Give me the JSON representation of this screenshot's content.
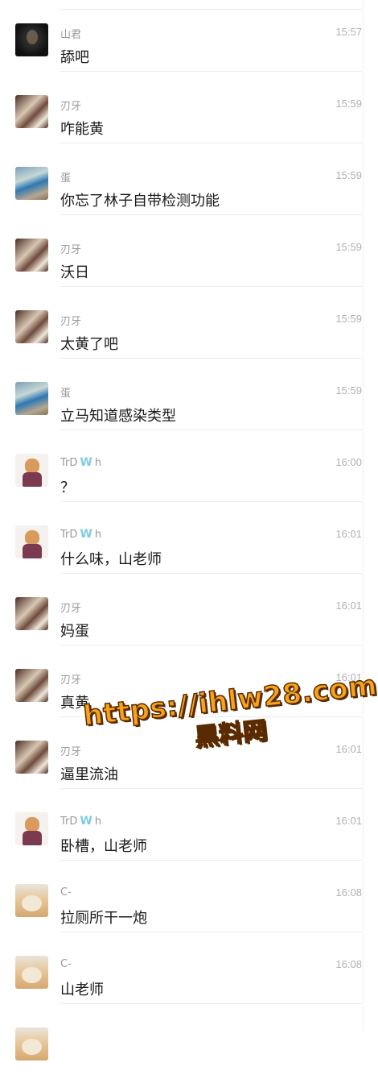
{
  "messages": [
    {
      "sender": "山君",
      "time": "15:57",
      "text": "舔吧",
      "avatar": "dark-portrait"
    },
    {
      "sender": "刃牙",
      "time": "15:59",
      "text": "咋能黄",
      "avatar": "flowers"
    },
    {
      "sender": "蛋",
      "time": "15:59",
      "text": "你忘了林子自带检测功能",
      "avatar": "egg-photo"
    },
    {
      "sender": "刃牙",
      "time": "15:59",
      "text": "沃日",
      "avatar": "flowers"
    },
    {
      "sender": "刃牙",
      "time": "15:59",
      "text": "太黄了吧",
      "avatar": "flowers"
    },
    {
      "sender": "蛋",
      "time": "15:59",
      "text": "立马知道感染类型",
      "avatar": "egg-photo"
    },
    {
      "sender": "TrD",
      "sender_suffix": "h",
      "badge": "W",
      "time": "16:00",
      "text": "？",
      "avatar": "shiba-suit"
    },
    {
      "sender": "TrD",
      "sender_suffix": "h",
      "badge": "W",
      "time": "16:01",
      "text": "什么味，山老师",
      "avatar": "shiba-suit"
    },
    {
      "sender": "刃牙",
      "time": "16:01",
      "text": "妈蛋",
      "avatar": "flowers"
    },
    {
      "sender": "刃牙",
      "time": "16:01",
      "text": "真黄",
      "avatar": "flowers"
    },
    {
      "sender": "刃牙",
      "time": "16:01",
      "text": "逼里流油",
      "avatar": "flowers"
    },
    {
      "sender": "TrD",
      "sender_suffix": "h",
      "badge": "W",
      "time": "16:01",
      "text": "卧槽，山老师",
      "avatar": "shiba-suit"
    },
    {
      "sender": "C-",
      "time": "16:08",
      "text": "拉厕所干一炮",
      "avatar": "doge"
    },
    {
      "sender": "C-",
      "time": "16:08",
      "text": "山老师",
      "avatar": "doge"
    }
  ],
  "watermark": {
    "url": "https://ihlw28.com",
    "site_name": "黑料网",
    "text_color": "#f6a21a"
  },
  "colors": {
    "sender": "#9a9a9a",
    "time": "#b1b1b1",
    "text": "#1a1a1a",
    "badge": "#7fcbe6"
  }
}
